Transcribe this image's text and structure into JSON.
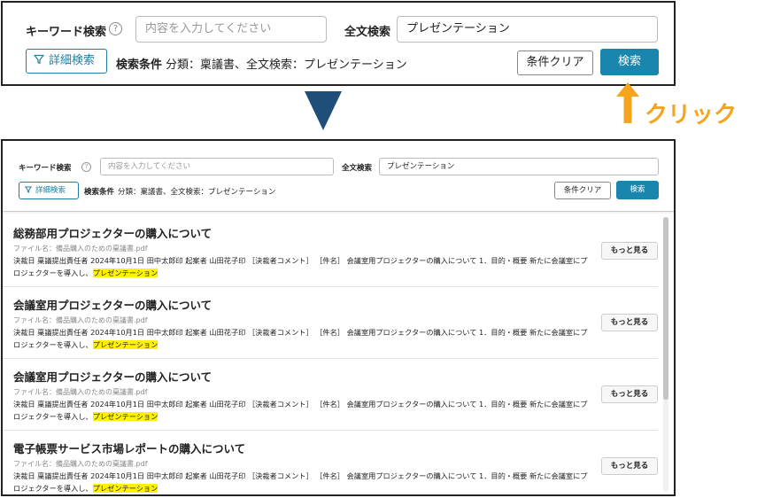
{
  "search": {
    "keyword_label": "キーワード検索",
    "keyword_placeholder": "内容を入力してください",
    "fulltext_label": "全文検索",
    "fulltext_value": "プレゼンテーション",
    "detail_button": "詳細検索",
    "conditions_label": "検索条件",
    "conditions_value": "分類：稟議書、全文検索：プレゼンテーション",
    "clear_button": "条件クリア",
    "search_button": "検索",
    "help_glyph": "?"
  },
  "annotation": {
    "click_label": "クリック",
    "arrow_color": "#1f4e79",
    "click_color": "#f4a41d"
  },
  "results": [
    {
      "title": "総務部用プロジェクターの購入について",
      "file": "ファイル名：備品購入のための稟議書.pdf",
      "snippet": "決裁日 稟議提出責任者 2024年10月1日 田中太郎印 起案者 山田花子印 ［決裁者コメント］ ［件名］ 会議室用プロジェクターの購入について 1．目的・概要 新たに会議室にプロジェクターを導入し、",
      "highlight": "プレゼンテーション",
      "more": "もっと見る"
    },
    {
      "title": "会議室用プロジェクターの購入について",
      "file": "ファイル名：備品購入のための稟議書.pdf",
      "snippet": "決裁日 稟議提出責任者 2024年10月1日 田中太郎印 起案者 山田花子印 ［決裁者コメント］ ［件名］ 会議室用プロジェクターの購入について 1．目的・概要 新たに会議室にプロジェクターを導入し、",
      "highlight": "プレゼンテーション",
      "more": "もっと見る"
    },
    {
      "title": "会議室用プロジェクターの購入について",
      "file": "ファイル名：備品購入のための稟議書.pdf",
      "snippet": "決裁日 稟議提出責任者 2024年10月1日 田中太郎印 起案者 山田花子印 ［決裁者コメント］ ［件名］ 会議室用プロジェクターの購入について 1．目的・概要 新たに会議室にプロジェクターを導入し、",
      "highlight": "プレゼンテーション",
      "more": "もっと見る"
    },
    {
      "title": "電子帳票サービス市場レポートの購入について",
      "file": "ファイル名：備品購入のための稟議書.pdf",
      "snippet": "決裁日 稟議提出責任者 2024年10月1日 田中太郎印 起案者 山田花子印 ［決裁者コメント］ ［件名］ 会議室用プロジェクターの購入について 1．目的・概要 新たに会議室にプロジェクターを導入し、",
      "highlight": "プレゼンテーション",
      "more": "もっと見る"
    }
  ]
}
